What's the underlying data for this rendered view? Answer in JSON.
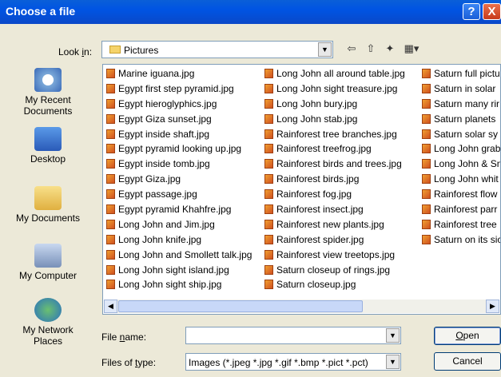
{
  "dialog": {
    "title": "Choose a file",
    "help": "?",
    "close": "X"
  },
  "toolbar": {
    "look_in_label_pre": "Look ",
    "look_in_label_u": "i",
    "look_in_label_post": "n:",
    "look_in_value": "Pictures",
    "back_icon": "back-arrow-icon",
    "up_icon": "up-folder-icon",
    "new_folder_icon": "new-folder-icon",
    "views_icon": "views-menu-icon"
  },
  "places": [
    {
      "label": "My Recent\nDocuments",
      "icon": "recent-documents-icon"
    },
    {
      "label": "Desktop",
      "icon": "desktop-icon"
    },
    {
      "label": "My Documents",
      "icon": "my-documents-icon"
    },
    {
      "label": "My Computer",
      "icon": "my-computer-icon"
    },
    {
      "label": "My Network\nPlaces",
      "icon": "network-places-icon"
    }
  ],
  "files": {
    "col1": [
      "Marine iguana.jpg",
      "Egypt first step pyramid.jpg",
      "Egypt hieroglyphics.jpg",
      "Egypt Giza sunset.jpg",
      "Egypt inside shaft.jpg",
      "Egypt pyramid looking up.jpg",
      "Egypt inside tomb.jpg",
      "Egypt Giza.jpg",
      "Egypt passage.jpg",
      "Egypt pyramid Khahfre.jpg",
      "Long John and Jim.jpg",
      "Long John knife.jpg",
      "Long John and Smollett talk.jpg",
      "Long John sight island.jpg",
      "Long John sight ship.jpg"
    ],
    "col2": [
      "Long John all around table.jpg",
      "Long John sight treasure.jpg",
      "Long John bury.jpg",
      "Long John stab.jpg",
      "Rainforest tree branches.jpg",
      "Rainforest treefrog.jpg",
      "Rainforest birds and trees.jpg",
      "Rainforest birds.jpg",
      "Rainforest fog.jpg",
      "Rainforest insect.jpg",
      "Rainforest new plants.jpg",
      "Rainforest spider.jpg",
      "Rainforest view treetops.jpg",
      "Saturn closeup of rings.jpg",
      "Saturn closeup.jpg"
    ],
    "col3": [
      "Saturn full pictu",
      "Saturn in solar",
      "Saturn many rir",
      "Saturn planets",
      "Saturn solar sy",
      "Long John grab",
      "Long John & Sn",
      "Long John whit",
      "Rainforest flow",
      "Rainforest parr",
      "Rainforest tree",
      "Saturn on its sic"
    ]
  },
  "form": {
    "file_name_pre": "File ",
    "file_name_u": "n",
    "file_name_post": "ame:",
    "file_name_value": "",
    "files_of_type_pre": "Files of ",
    "files_of_type_u": "t",
    "files_of_type_post": "ype:",
    "files_of_type_value": "Images (*.jpeg *.jpg *.gif *.bmp *.pict *.pct)",
    "open_u": "O",
    "open_rest": "pen",
    "cancel": "Cancel"
  }
}
